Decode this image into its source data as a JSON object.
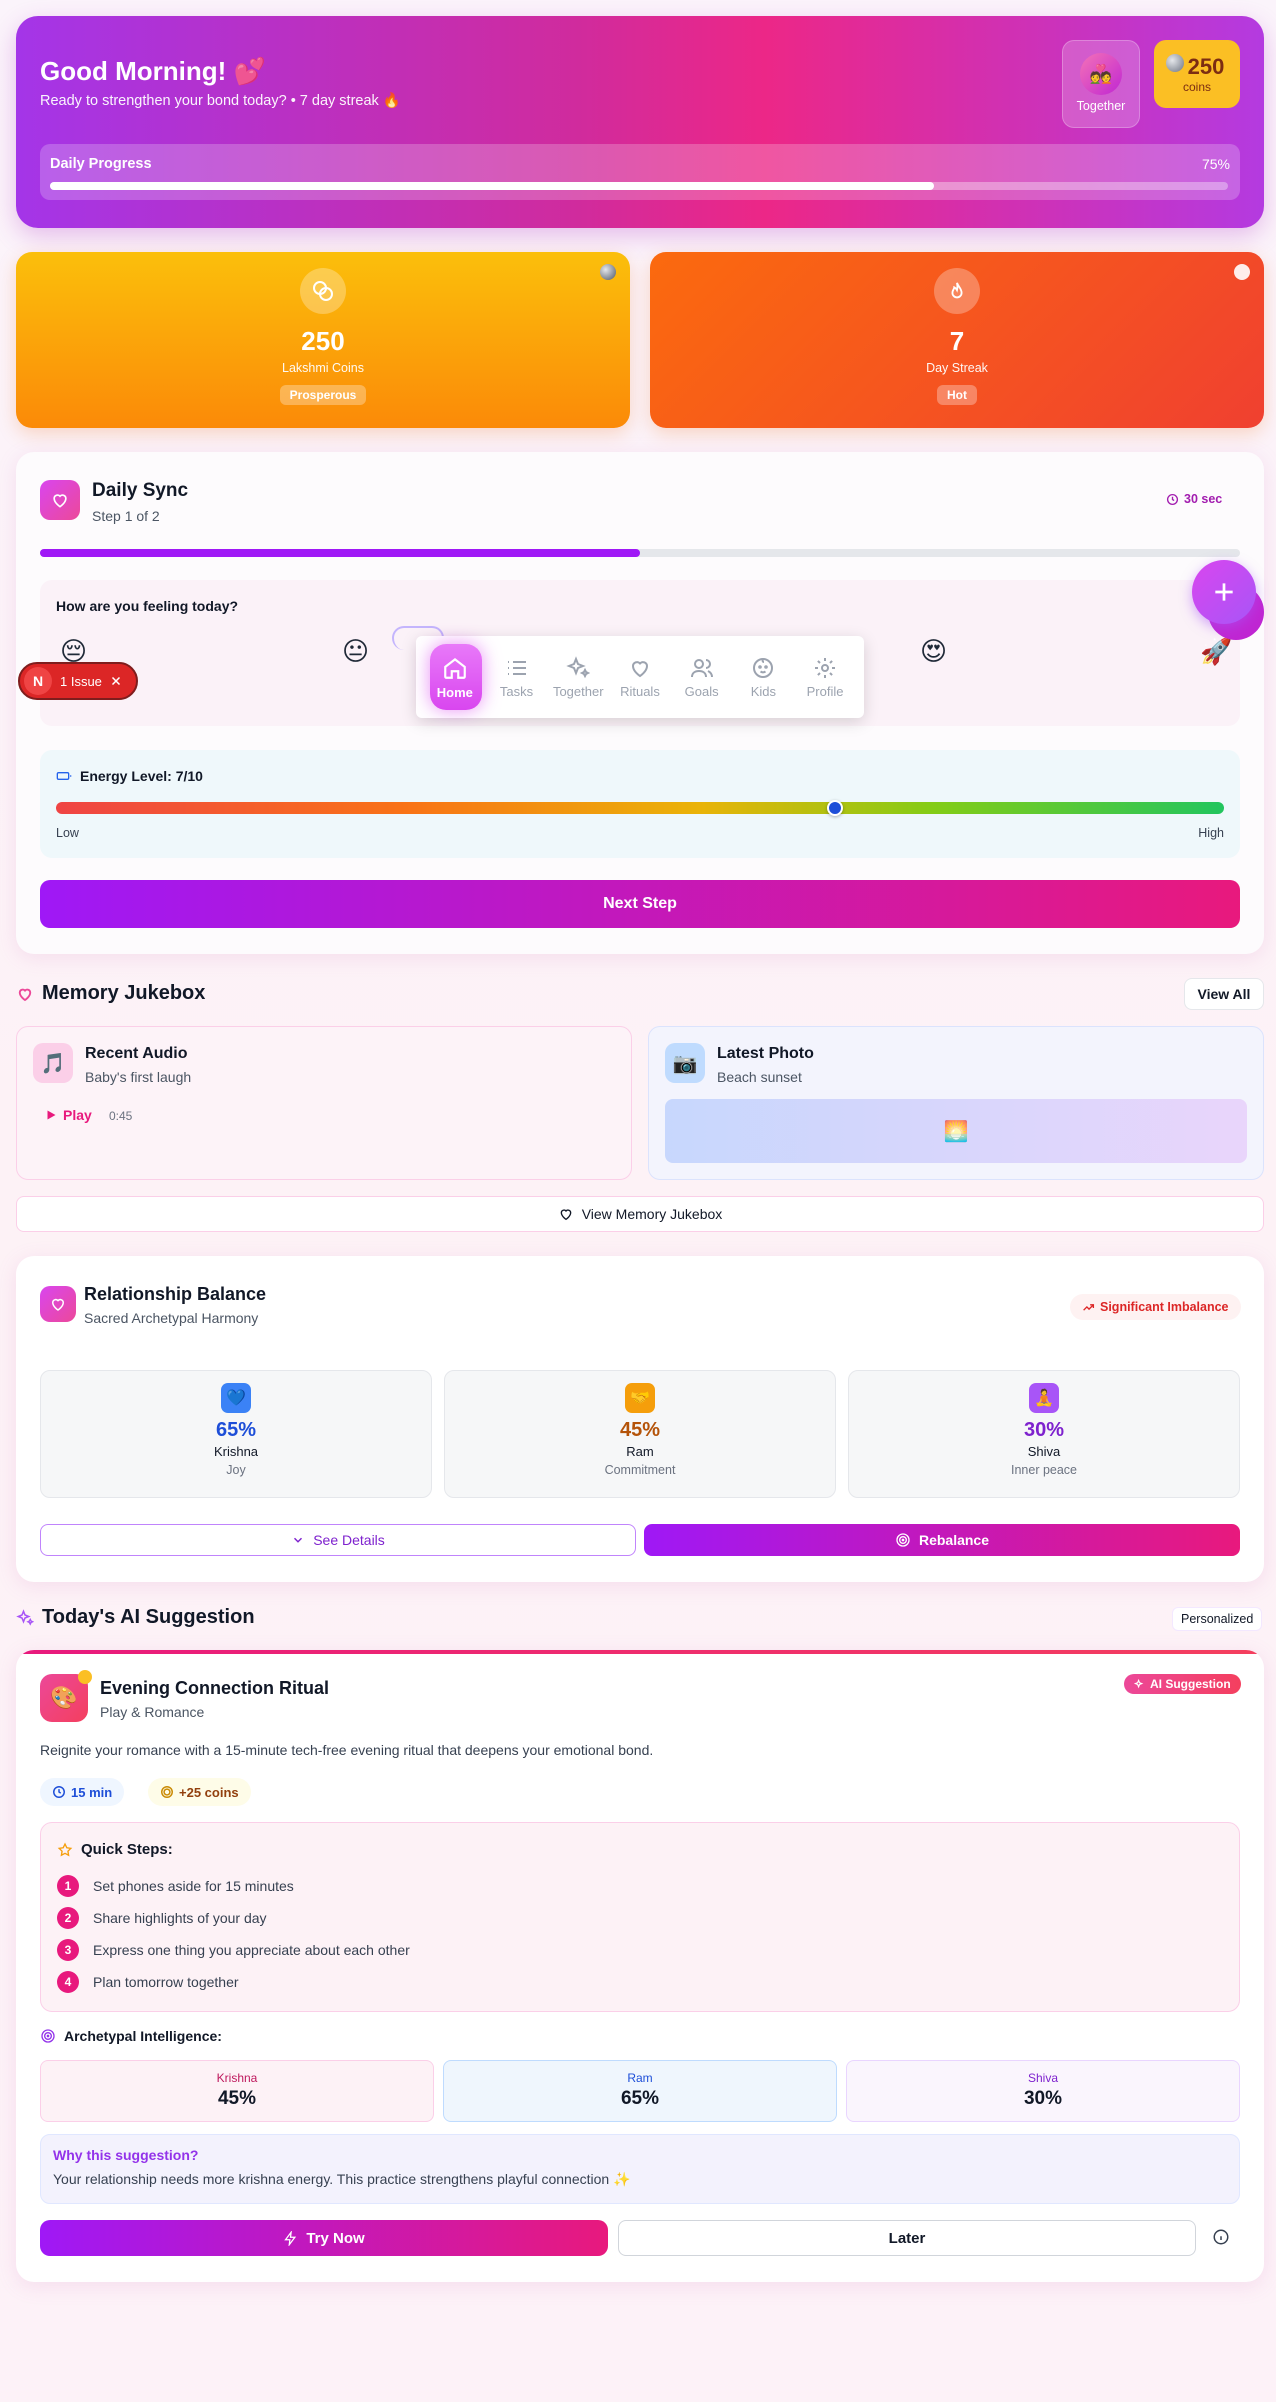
{
  "hero": {
    "greeting": "Good Morning! 💕",
    "subtitle": "Ready to strengthen your bond today? • 7 day streak 🔥",
    "together_label": "Together",
    "together_emoji": "💑",
    "coins_value": "250",
    "coins_label": "coins",
    "progress_label": "Daily Progress",
    "progress_percent": "75%",
    "progress_fraction": 0.75
  },
  "stats": [
    {
      "value": "250",
      "label": "Lakshmi Coins",
      "badge": "Prosperous"
    },
    {
      "value": "7",
      "label": "Day Streak",
      "badge": "Hot"
    }
  ],
  "sync": {
    "title": "Daily Sync",
    "step": "Step 1 of 2",
    "timer": "30 sec",
    "step_progress": 0.5,
    "feeling_question": "How are you feeling today?",
    "moods": [
      "😔",
      "😐",
      "😍",
      "🚀"
    ],
    "energy_label": "Energy Level: 7/10",
    "energy_value": 7,
    "energy_max": 10,
    "energy_low": "Low",
    "energy_high": "High",
    "next_label": "Next Step"
  },
  "nav": {
    "items": [
      "Home",
      "Tasks",
      "Together",
      "Rituals",
      "Goals",
      "Kids",
      "Profile"
    ]
  },
  "issue": {
    "avatar": "N",
    "label": "1 Issue"
  },
  "memory": {
    "title": "Memory Jukebox",
    "view_all": "View All",
    "audio": {
      "title": "Recent Audio",
      "subtitle": "Baby's first laugh",
      "play": "Play",
      "duration": "0:45",
      "icon": "🎵"
    },
    "photo": {
      "title": "Latest Photo",
      "subtitle": "Beach sunset",
      "icon": "📷",
      "thumb": "🌅"
    },
    "view_button": "View Memory Jukebox"
  },
  "balance": {
    "title": "Relationship Balance",
    "subtitle": "Sacred Archetypal Harmony",
    "badge": "Significant Imbalance",
    "archetypes": [
      {
        "percent": "65%",
        "name": "Krishna",
        "desc": "Joy",
        "icon": "💙",
        "color": "#1d4ed8"
      },
      {
        "percent": "45%",
        "name": "Ram",
        "desc": "Commitment",
        "icon": "🤝",
        "color": "#b45309"
      },
      {
        "percent": "30%",
        "name": "Shiva",
        "desc": "Inner peace",
        "icon": "🧘",
        "color": "#7e22ce"
      }
    ],
    "details_label": "See Details",
    "rebalance_label": "Rebalance"
  },
  "ai": {
    "section_title": "Today's AI Suggestion",
    "personalized": "Personalized",
    "title": "Evening Connection Ritual",
    "category": "Play & Romance",
    "badge": "AI Suggestion",
    "icon": "🎨",
    "description": "Reignite your romance with a 15-minute tech-free evening ritual that deepens your emotional bond.",
    "time": "15 min",
    "coins": "+25 coins",
    "steps_title": "Quick Steps:",
    "steps": [
      "Set phones aside for 15 minutes",
      "Share highlights of your day",
      "Express one thing you appreciate about each other",
      "Plan tomorrow together"
    ],
    "intel_title": "Archetypal Intelligence:",
    "intel": [
      {
        "name": "Krishna",
        "value": "45%"
      },
      {
        "name": "Ram",
        "value": "65%"
      },
      {
        "name": "Shiva",
        "value": "30%"
      }
    ],
    "why_title": "Why this suggestion?",
    "why_text": "Your relationship needs more krishna energy. This practice strengthens playful connection ✨",
    "try_label": "Try Now",
    "later_label": "Later"
  }
}
